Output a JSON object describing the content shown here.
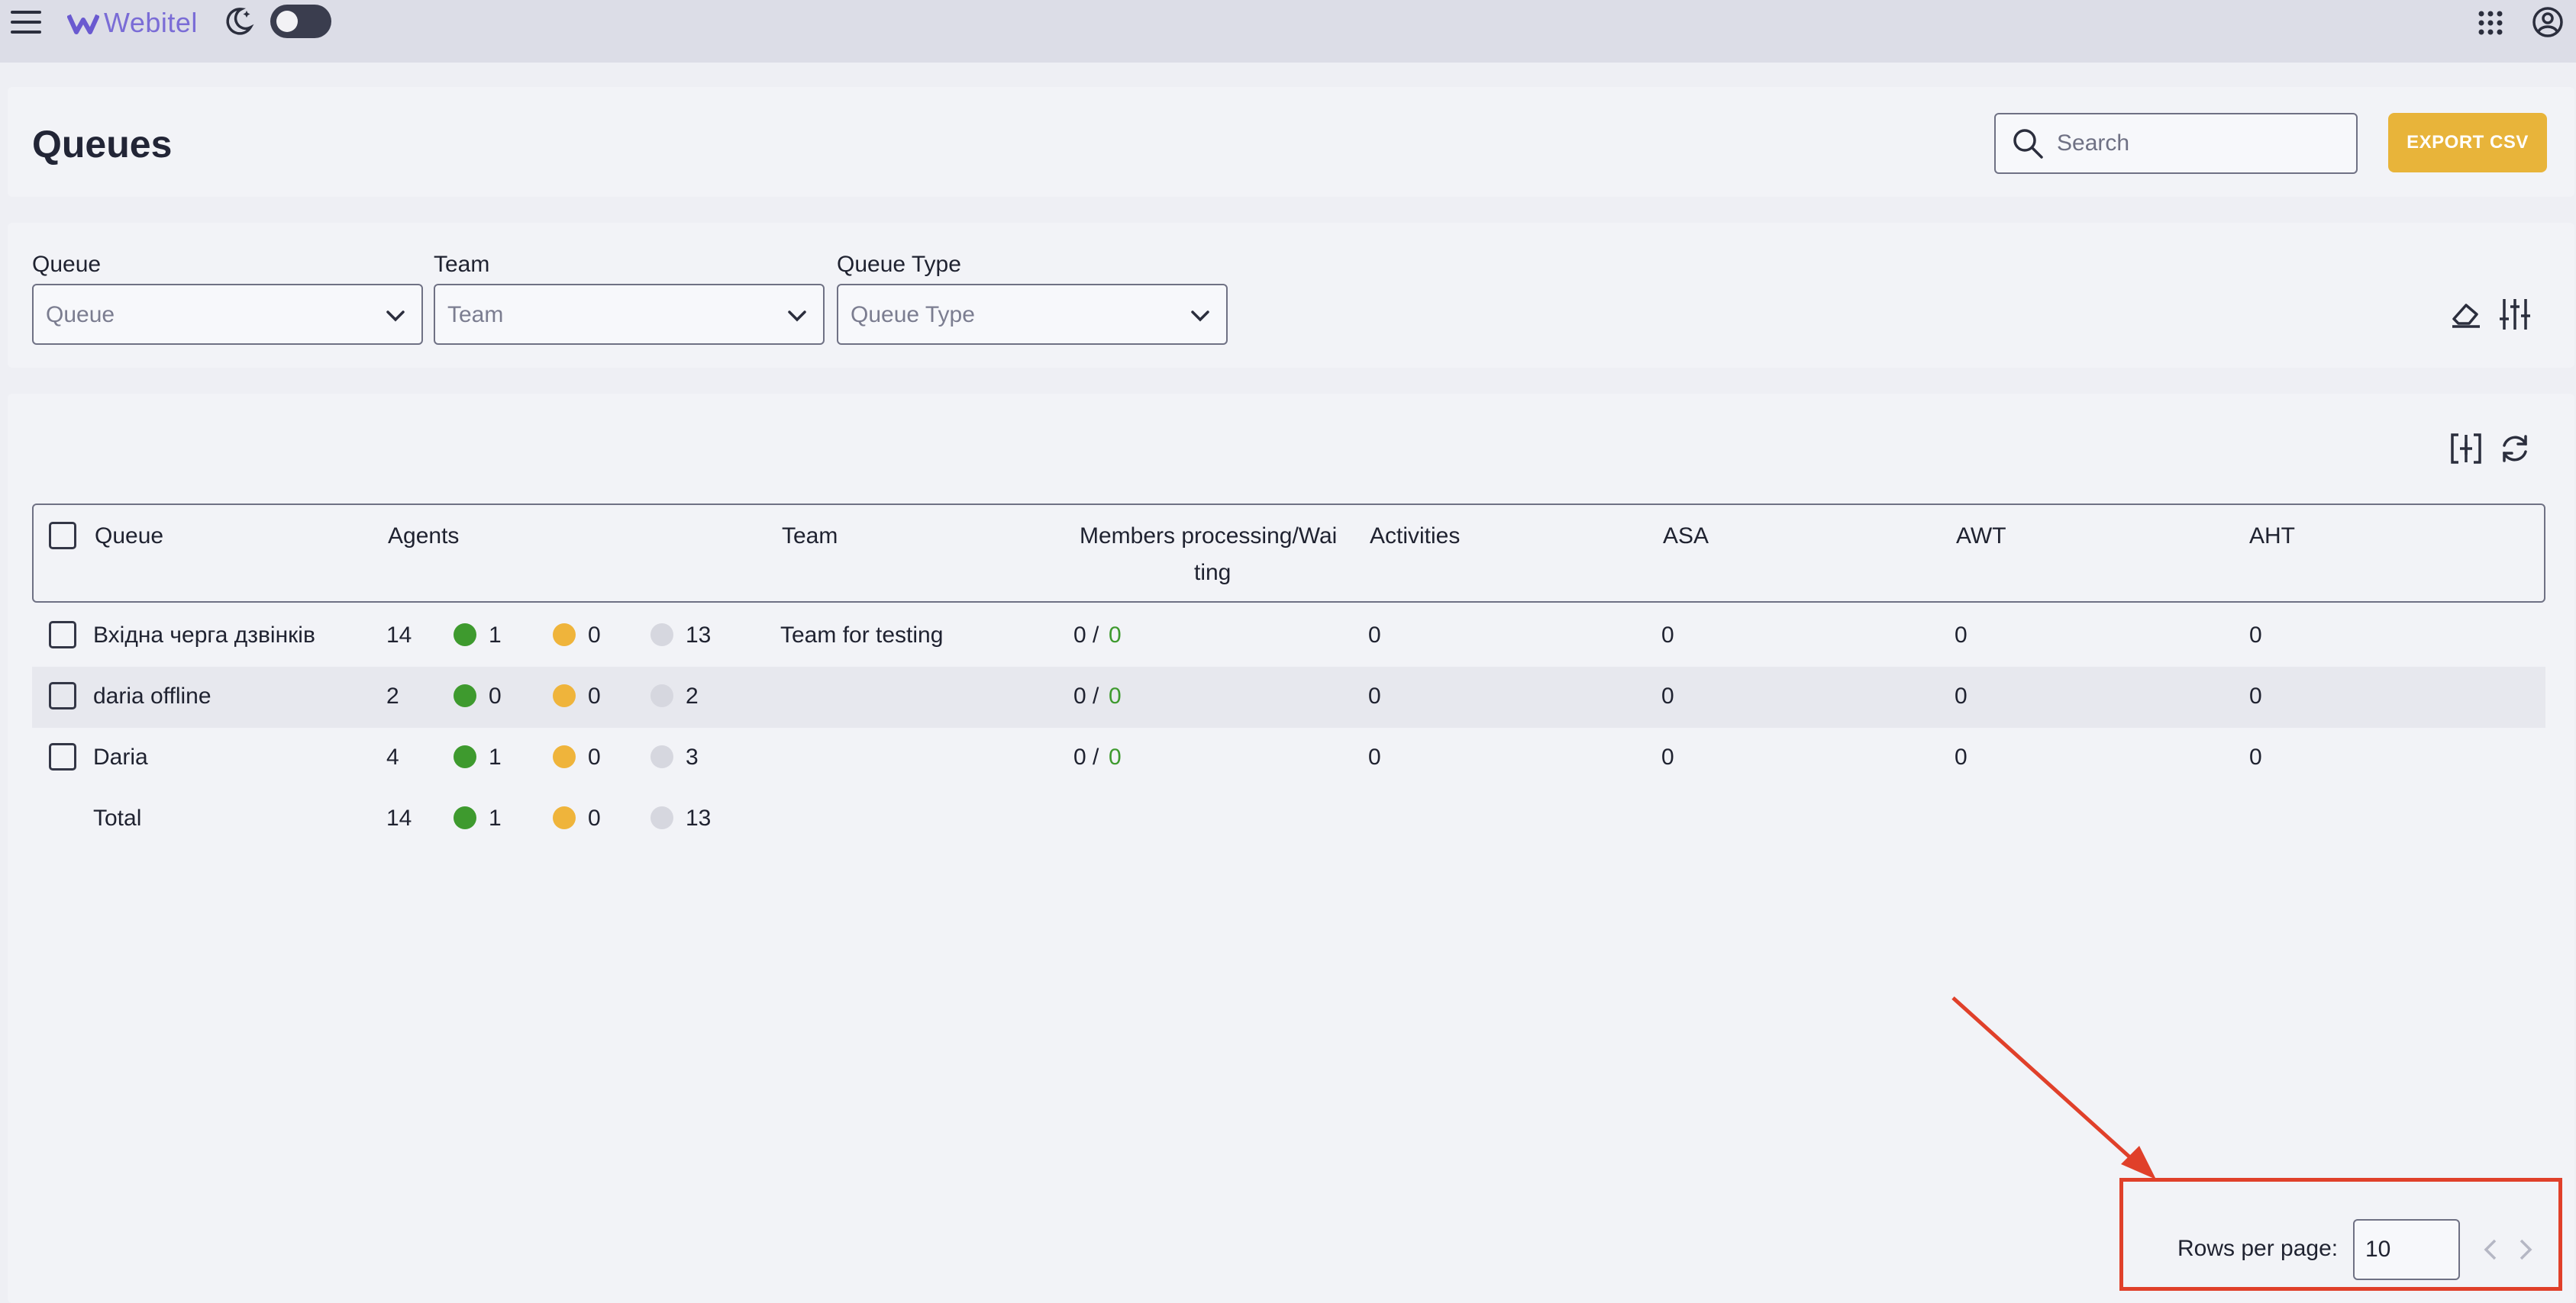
{
  "app": {
    "brand": "Webitel"
  },
  "page": {
    "title": "Queues"
  },
  "search": {
    "placeholder": "Search"
  },
  "actions": {
    "export_label": "EXPORT CSV"
  },
  "filters": [
    {
      "label": "Queue",
      "placeholder": "Queue"
    },
    {
      "label": "Team",
      "placeholder": "Team"
    },
    {
      "label": "Queue Type",
      "placeholder": "Queue Type"
    }
  ],
  "table": {
    "columns": {
      "queue": "Queue",
      "agents": "Agents",
      "team": "Team",
      "members_line1": "Members processing/Wai",
      "members_line2": "ting",
      "activities": "Activities",
      "asa": "ASA",
      "awt": "AWT",
      "aht": "AHT"
    },
    "rows": [
      {
        "queue": "Вхідна черга дзвінків",
        "agents_total": "14",
        "online": "1",
        "pause": "0",
        "offline": "13",
        "team": "Team for testing",
        "processing": "0 /",
        "waiting": "0",
        "activities": "0",
        "asa": "0",
        "awt": "0",
        "aht": "0"
      },
      {
        "queue": "daria offline",
        "agents_total": "2",
        "online": "0",
        "pause": "0",
        "offline": "2",
        "team": "",
        "processing": "0 /",
        "waiting": "0",
        "activities": "0",
        "asa": "0",
        "awt": "0",
        "aht": "0"
      },
      {
        "queue": "Daria",
        "agents_total": "4",
        "online": "1",
        "pause": "0",
        "offline": "3",
        "team": "",
        "processing": "0 /",
        "waiting": "0",
        "activities": "0",
        "asa": "0",
        "awt": "0",
        "aht": "0"
      }
    ],
    "total": {
      "label": "Total",
      "agents_total": "14",
      "online": "1",
      "pause": "0",
      "offline": "13"
    }
  },
  "pagination": {
    "rows_per_page_label": "Rows per page:",
    "rows_per_page_value": "10"
  },
  "colors": {
    "accent": "#e8b43a",
    "online": "#3e9a2e",
    "pause": "#efb43b",
    "offline": "#d6d7df",
    "highlight": "#e0402a"
  }
}
